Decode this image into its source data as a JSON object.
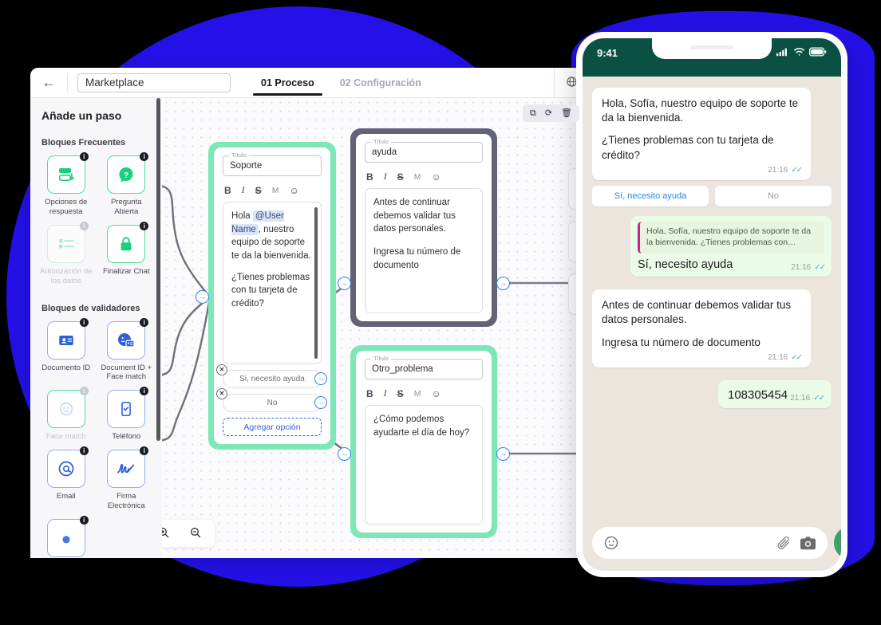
{
  "app": {
    "back_icon": "←",
    "name_value": "Marketplace",
    "tabs": [
      {
        "label": "01 Proceso",
        "active": true
      },
      {
        "label": "02 Configuración",
        "active": false
      }
    ],
    "globe_icon": "⊕"
  },
  "sidebar": {
    "title": "Añade un paso",
    "sections": [
      {
        "heading": "Bloques Frecuentes",
        "blocks": [
          {
            "label": "Opciones de respuesta",
            "badge": "i",
            "style": "green",
            "icon": "options-icon"
          },
          {
            "label": "Pregunta Abierta",
            "badge": "i",
            "style": "green",
            "icon": "question-bubble-icon"
          },
          {
            "label": "Autorización de los datos",
            "badge": "i",
            "style": "green-muted",
            "icon": "checklist-icon"
          },
          {
            "label": "Finalizar Chat",
            "badge": "i",
            "style": "green",
            "icon": "lock-icon"
          }
        ]
      },
      {
        "heading": "Bloques de validadores",
        "blocks": [
          {
            "label": "Documento ID",
            "badge": "i",
            "style": "blue",
            "icon": "id-card-icon"
          },
          {
            "label": "Document ID + Face match",
            "badge": "i",
            "style": "blue",
            "icon": "id-face-match-icon"
          },
          {
            "label": "Face match",
            "badge": "i",
            "style": "blue-muted",
            "icon": "face-icon"
          },
          {
            "label": "Teléfono",
            "badge": "i",
            "style": "blue",
            "icon": "phone-check-icon"
          },
          {
            "label": "Email",
            "badge": "i",
            "style": "blue",
            "icon": "at-icon"
          },
          {
            "label": "Firma Electrónica",
            "badge": "i",
            "style": "blue",
            "icon": "signature-icon"
          }
        ]
      }
    ]
  },
  "canvas": {
    "float_tools": [
      {
        "name": "duplicate-icon",
        "glyph": "⧉"
      },
      {
        "name": "sync-icon",
        "glyph": "⟳"
      },
      {
        "name": "trash-icon",
        "glyph": "🗑"
      }
    ],
    "zoom_controls": [
      {
        "name": "zoom-in-icon",
        "glyph": "🔍"
      },
      {
        "name": "zoom-out-icon",
        "glyph": "⊖"
      }
    ],
    "nodes": [
      {
        "id": "soporte",
        "title_label": "Título",
        "title_value": "Soporte",
        "toolbar": {
          "bold": "B",
          "italic": "I",
          "strike": "S",
          "mono": "M",
          "emoji": "☺"
        },
        "message_pre": "Hola ",
        "mention": "@User Name",
        "message_rest": ", nuestro equipo de soporte te da la bienvenida.",
        "message_second": "¿Tienes problemas con tu tarjeta de crédito?",
        "options": [
          "Si, necesito ayuda",
          "No"
        ],
        "add_option": "Agregar opción"
      },
      {
        "id": "ayuda",
        "title_label": "Título",
        "title_value": "ayuda",
        "toolbar": {
          "bold": "B",
          "italic": "I",
          "strike": "S",
          "mono": "M",
          "emoji": "☺"
        },
        "message_first": "Antes de continuar debemos validar tus datos personales.",
        "message_second": "Ingresa tu número de documento"
      },
      {
        "id": "otro_problema",
        "title_label": "Título",
        "title_value": "Otro_problema",
        "toolbar": {
          "bold": "B",
          "italic": "I",
          "strike": "S",
          "mono": "M",
          "emoji": "☺"
        },
        "message_first": "¿Cómo podemos ayudarte el día de hoy?"
      }
    ]
  },
  "phone": {
    "status": {
      "time": "9:41",
      "signal_icon": "signal-bars-icon",
      "wifi_icon": "wifi-icon",
      "battery_icon": "battery-icon"
    },
    "messages": [
      {
        "type": "in",
        "line1": "Hola, Sofía,  nuestro equipo de soporte te da la bienvenida.",
        "line2": "¿Tienes problemas con tu tarjeta de crédito?",
        "time": "21:16"
      },
      {
        "type": "quick-replies",
        "buttons": [
          "Sí, necesito ayuda",
          "No"
        ]
      },
      {
        "type": "out-quote",
        "quote": "Hola, Sofía,  nuestro equipo de soporte te da la bienvenida. ¿Tienes problemas con…",
        "text": "Sí, necesito ayuda",
        "time": "21:16"
      },
      {
        "type": "in",
        "line1": "Antes de continuar debemos validar tus datos personales.",
        "line2": "Ingresa tu número de documento",
        "time": "21:16"
      },
      {
        "type": "out",
        "text": "108305454",
        "time": "21:16"
      }
    ],
    "composer": {
      "emoji_icon": "☺",
      "placeholder": "",
      "attach_icon": "attachment-icon",
      "camera_icon": "camera-icon",
      "mic_icon": "microphone-icon"
    }
  },
  "colors": {
    "brand_blue": "#2311E8",
    "node_green": "#7de8b6",
    "node_selected": "#636377",
    "port_blue": "#2f7ff0",
    "whatsapp_header": "#0a5043",
    "chat_bg": "#ece5dd"
  }
}
